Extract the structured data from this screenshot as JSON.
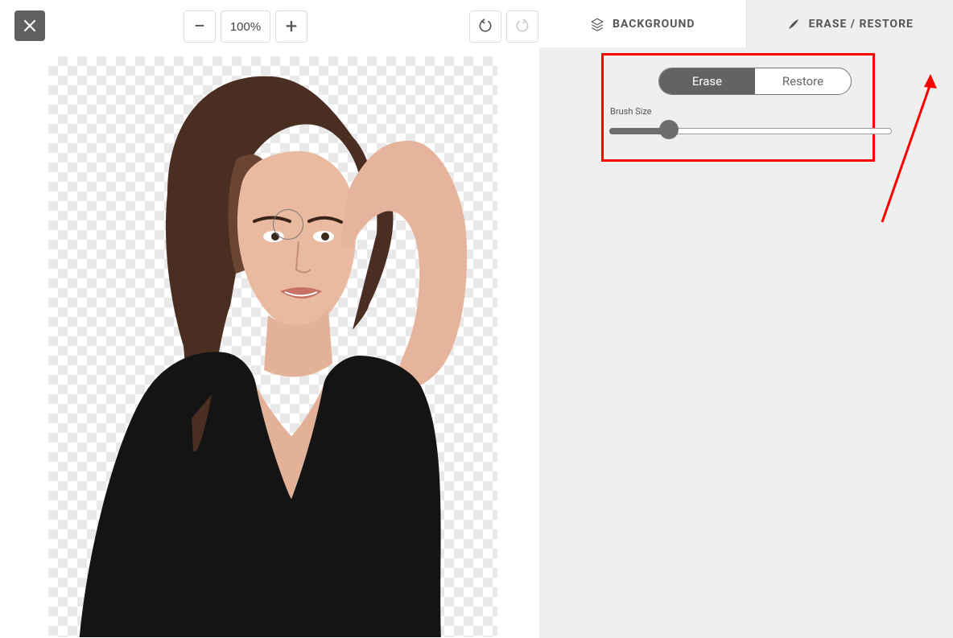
{
  "toolbar": {
    "zoom_value": "100%",
    "zoom_out_label": "−",
    "zoom_in_label": "+"
  },
  "tabs": {
    "background": "Background",
    "erase_restore": "Erase / Restore",
    "active": "erase_restore"
  },
  "panel": {
    "toggle_erase": "Erase",
    "toggle_restore": "Restore",
    "toggle_active": "erase",
    "brush_label": "Brush Size",
    "brush_value": 20,
    "brush_min": 0,
    "brush_max": 100
  }
}
